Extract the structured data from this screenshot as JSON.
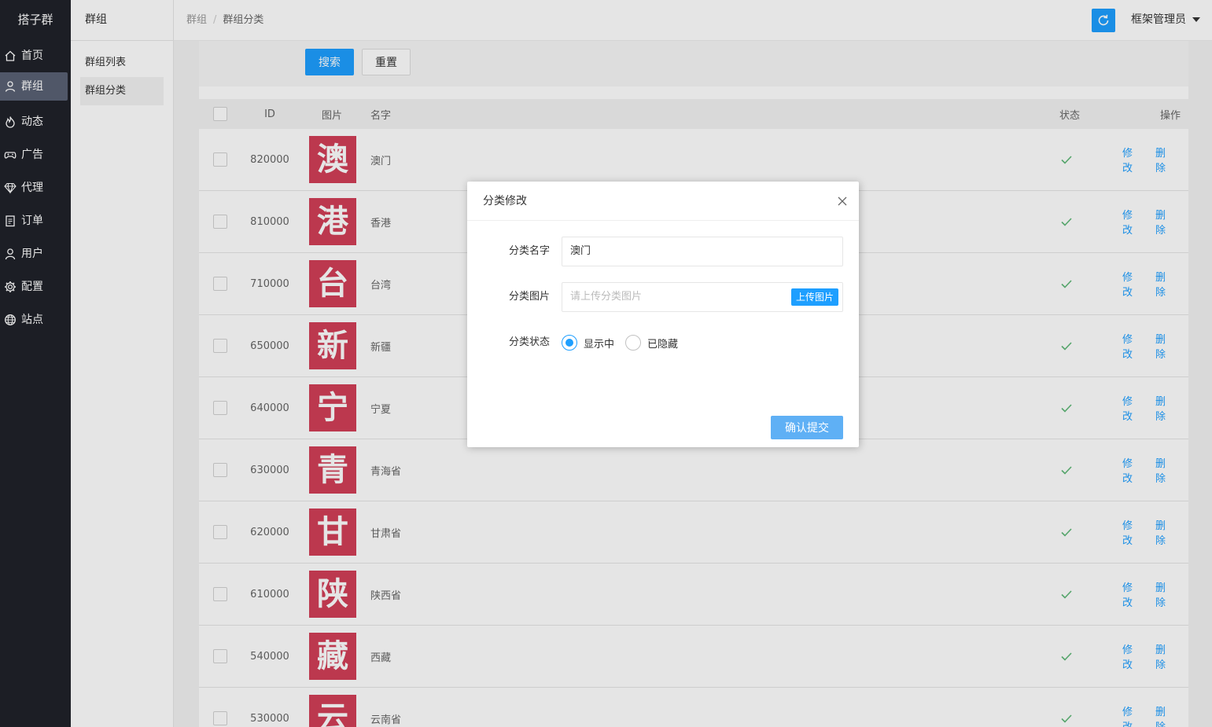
{
  "app": {
    "logo": "搭子群"
  },
  "sidebar": {
    "items": [
      {
        "label": "首页",
        "icon": "home-icon"
      },
      {
        "label": "群组",
        "icon": "user-icon",
        "active": true
      },
      {
        "label": "动态",
        "icon": "fire-icon"
      },
      {
        "label": "广告",
        "icon": "gamepad-icon"
      },
      {
        "label": "代理",
        "icon": "diamond-icon"
      },
      {
        "label": "订单",
        "icon": "clipboard-icon"
      },
      {
        "label": "用户",
        "icon": "person-icon"
      },
      {
        "label": "配置",
        "icon": "gear-icon"
      },
      {
        "label": "站点",
        "icon": "globe-icon"
      }
    ]
  },
  "subsidebar": {
    "title": "群组",
    "items": [
      {
        "label": "群组列表"
      },
      {
        "label": "群组分类",
        "active": true
      }
    ]
  },
  "header": {
    "breadcrumb": [
      "群组",
      "群组分类"
    ],
    "breadcrumb_sep": "/",
    "admin_name": "框架管理员",
    "refresh_icon": "refresh-icon"
  },
  "search": {
    "search_label": "搜索",
    "reset_label": "重置"
  },
  "table": {
    "columns": {
      "id": "ID",
      "image": "图片",
      "name": "名字",
      "status": "状态",
      "action": "操作"
    },
    "edit_label": "修改",
    "delete_label": "删除",
    "rows": [
      {
        "id": "820000",
        "thumb": "澳",
        "name": "澳门"
      },
      {
        "id": "810000",
        "thumb": "港",
        "name": "香港"
      },
      {
        "id": "710000",
        "thumb": "台",
        "name": "台湾"
      },
      {
        "id": "650000",
        "thumb": "新",
        "name": "新疆"
      },
      {
        "id": "640000",
        "thumb": "宁",
        "name": "宁夏"
      },
      {
        "id": "630000",
        "thumb": "青",
        "name": "青海省"
      },
      {
        "id": "620000",
        "thumb": "甘",
        "name": "甘肃省"
      },
      {
        "id": "610000",
        "thumb": "陕",
        "name": "陕西省"
      },
      {
        "id": "540000",
        "thumb": "藏",
        "name": "西藏"
      },
      {
        "id": "530000",
        "thumb": "云",
        "name": "云南省"
      }
    ]
  },
  "modal": {
    "title": "分类修改",
    "name_label": "分类名字",
    "name_value": "澳门",
    "image_label": "分类图片",
    "image_placeholder": "请上传分类图片",
    "upload_label": "上传图片",
    "status_label": "分类状态",
    "status_options": [
      "显示中",
      "已隐藏"
    ],
    "status_selected": "显示中",
    "submit_label": "确认提交"
  },
  "colors": {
    "accent": "#1e9fff",
    "sidebar_bg": "#20222a",
    "thumb_bg": "#d23f57",
    "check_green": "#5fb878"
  }
}
